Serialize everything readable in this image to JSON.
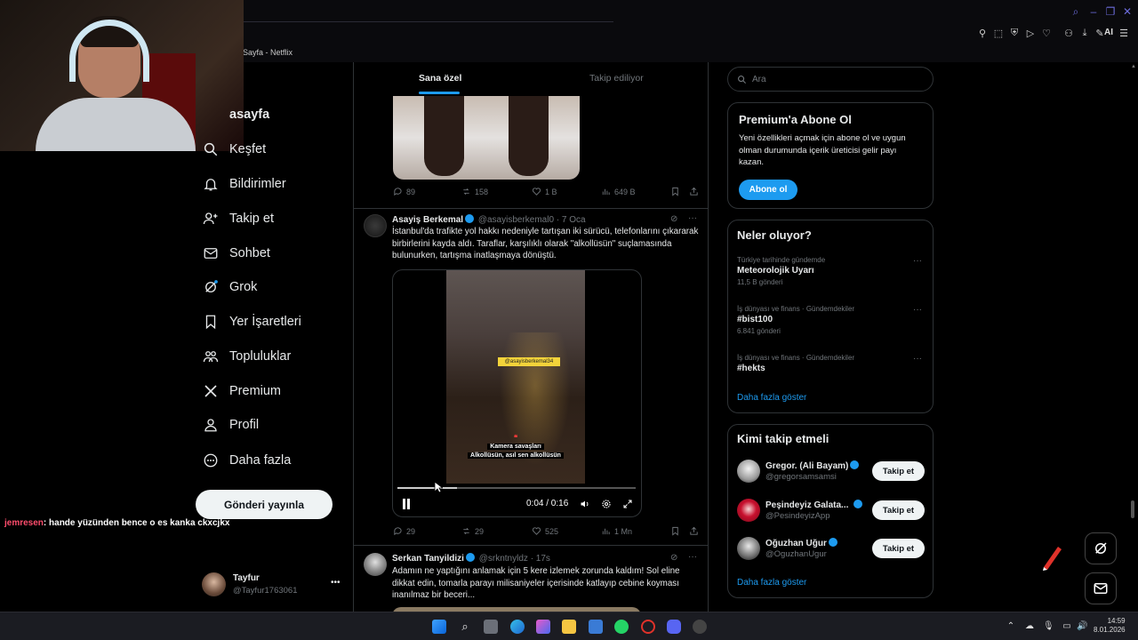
{
  "browser": {
    "tab_title": "Sayfa - Netflix",
    "ai_label": "AI"
  },
  "nav": {
    "home": "Anasayfa",
    "home_visible": "asayfa",
    "explore": "Keşfet",
    "notifications": "Bildirimler",
    "follow": "Takip et",
    "chat": "Sohbet",
    "grok": "Grok",
    "bookmarks": "Yer İşaretleri",
    "communities": "Topluluklar",
    "premium": "Premium",
    "profile": "Profil",
    "more": "Daha fazla",
    "post_button": "Gönderi yayınla"
  },
  "chat_overlay": {
    "user": "jemresen",
    "message": ": hande yüzünden bence o es kanka ckxcjkx"
  },
  "account": {
    "name": "Tayfur",
    "handle": "@Tayfur1763061"
  },
  "timeline": {
    "tabs": [
      "Sana özel",
      "Takip ediliyor"
    ],
    "posts": [
      {
        "stats": {
          "replies": "89",
          "reposts": "158",
          "likes": "1 B",
          "views": "649 B"
        }
      },
      {
        "name": "Asayiş Berkemal",
        "handle": "@asayisberkemal0",
        "time": "· 7 Oca",
        "text": "İstanbul'da trafikte yol hakkı nedeniyle tartışan iki sürücü, telefonlarını çıkararak birbirlerini kayda aldı. Taraflar, karşılıklı olarak \"alkollüsün\" suçlamasında bulunurken, tartışma inatlaşmaya dönüştü.",
        "video": {
          "handle_tag": "@asayisberkemal34",
          "caption_line1": "Kamera savaşları",
          "caption_line2": "Alkollüsün, asıl sen alkollüsün",
          "time": "0:04 / 0:16",
          "progress": 0.25
        },
        "stats": {
          "replies": "29",
          "reposts": "29",
          "likes": "525",
          "views": "1 Mn"
        }
      },
      {
        "name": "Serkan Tanyildizi",
        "handle": "@srkntnyldz",
        "time": "· 17s",
        "text": "Adamın ne yaptığını anlamak için 5 kere izlemek zorunda kaldım! Sol eline dikkat edin, tomarla parayı milisaniyeler içerisinde katlayıp cebine koyması inanılmaz bir beceri..."
      }
    ]
  },
  "sidebar": {
    "search_placeholder": "Ara",
    "premium": {
      "title": "Premium'a Abone Ol",
      "desc": "Yeni özellikleri açmak için abone ol ve uygun olman durumunda içerik üreticisi gelir payı kazan.",
      "button": "Abone ol"
    },
    "trends": {
      "title": "Neler oluyor?",
      "items": [
        {
          "meta": "Türkiye tarihinde gündemde",
          "title": "Meteorolojik Uyarı",
          "count": "11,5 B gönderi"
        },
        {
          "meta": "İş dünyası ve finans · Gündemdekiler",
          "title": "#bist100",
          "count": "6.841 gönderi"
        },
        {
          "meta": "İş dünyası ve finans · Gündemdekiler",
          "title": "#hekts",
          "count": ""
        }
      ],
      "show_more": "Daha fazla göster"
    },
    "who_to_follow": {
      "title": "Kimi takip etmeli",
      "items": [
        {
          "name": "Gregor. (Ali Bayam)",
          "handle": "@gregorsamsamsi",
          "button": "Takip et"
        },
        {
          "name": "Peşindeyiz Galata...",
          "handle": "@PesindeyizApp",
          "button": "Takip et"
        },
        {
          "name": "Oğuzhan Uğur",
          "handle": "@OguzhanUgur",
          "button": "Takip et"
        }
      ],
      "show_more": "Daha fazla göster"
    }
  },
  "taskbar": {
    "time": "14:59",
    "date": "8.01.2026"
  },
  "colors": {
    "accent": "#1d9bf0",
    "background": "#000000",
    "border": "#2f3336",
    "muted_text": "#71767b"
  }
}
